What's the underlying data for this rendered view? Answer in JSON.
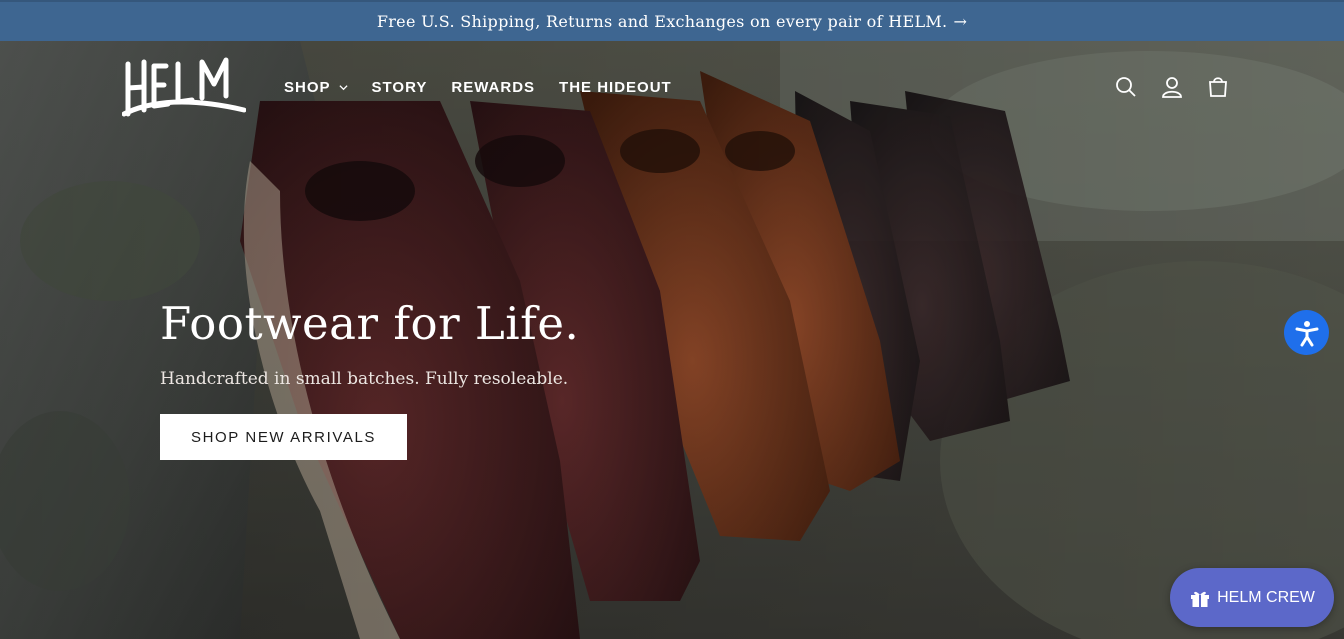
{
  "announcement": {
    "text": "Free U.S. Shipping, Returns and Exchanges on every pair of HELM.",
    "arrow": "→"
  },
  "brand": {
    "logo_text": "HELM"
  },
  "nav": {
    "items": [
      {
        "label": "SHOP",
        "has_dropdown": true
      },
      {
        "label": "STORY"
      },
      {
        "label": "REWARDS"
      },
      {
        "label": "THE HIDEOUT"
      }
    ]
  },
  "header_icons": [
    "search-icon",
    "account-icon",
    "cart-icon"
  ],
  "hero": {
    "headline": "Footwear for Life.",
    "subheadline": "Handcrafted in small batches. Fully resoleable.",
    "cta_label": "SHOP NEW ARRIVALS"
  },
  "widgets": {
    "accessibility_icon": "accessibility-icon",
    "rewards_label": "HELM CREW",
    "rewards_icon": "gift-icon"
  },
  "colors": {
    "announcement_bg": "#3e6691",
    "accessibility_bg": "#1f6feb",
    "rewards_bg": "#5c68c9"
  }
}
